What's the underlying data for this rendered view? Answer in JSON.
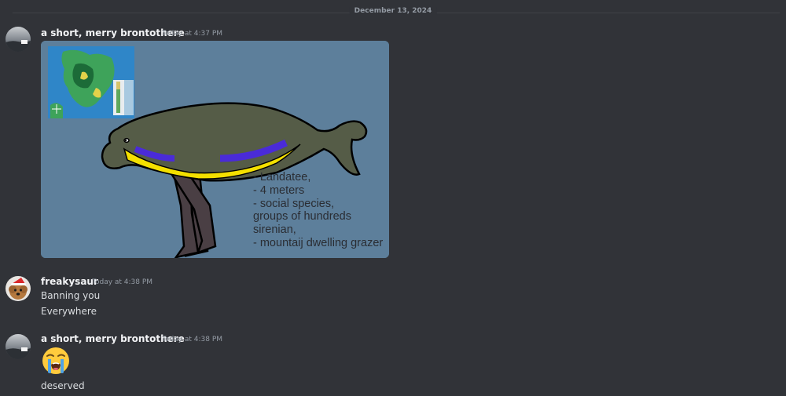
{
  "date_divider": "December 13, 2024",
  "messages": [
    {
      "username": "a short, merry brontothere",
      "timestamp": "Today at 4:37 PM",
      "attachment": {
        "caption_lines": [
          "- Landatee,",
          "- 4 meters",
          "- social species,",
          "groups of hundreds",
          "sirenian,",
          "- mountaij dwelling grazer"
        ]
      }
    },
    {
      "username": "freakysaur",
      "timestamp": "Today at 4:38 PM",
      "lines": [
        "Banning you",
        "Everywhere"
      ]
    },
    {
      "username": "a short, merry brontothere",
      "timestamp": "Today at 4:38 PM",
      "emoji": "loudly-crying-face",
      "lines": [
        "deserved"
      ]
    }
  ],
  "colors": {
    "background": "#313338",
    "username": "#f2f3f5",
    "timestamp": "#949ba4",
    "text": "#dbdee1",
    "attachment_bg": "#5d7f9b"
  }
}
